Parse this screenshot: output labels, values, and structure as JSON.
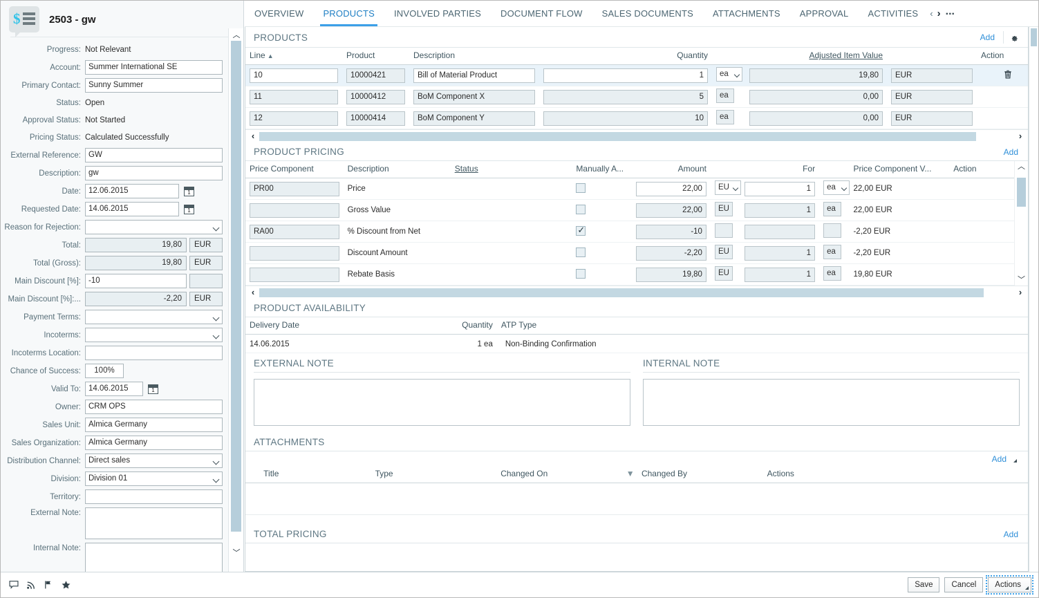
{
  "header": {
    "title": "2503 - gw",
    "icon": "sales-document-icon"
  },
  "tabs": [
    {
      "label": "OVERVIEW",
      "active": false
    },
    {
      "label": "PRODUCTS",
      "active": true
    },
    {
      "label": "INVOLVED PARTIES",
      "active": false
    },
    {
      "label": "DOCUMENT FLOW",
      "active": false
    },
    {
      "label": "SALES DOCUMENTS",
      "active": false
    },
    {
      "label": "ATTACHMENTS",
      "active": false
    },
    {
      "label": "APPROVAL",
      "active": false
    },
    {
      "label": "ACTIVITIES",
      "active": false
    }
  ],
  "tabnav": {
    "prev": "‹",
    "next": "›",
    "more": "..."
  },
  "sidebar": {
    "fields": [
      {
        "label": "Progress:",
        "value": "Not Relevant",
        "type": "text"
      },
      {
        "label": "Account:",
        "value": "Summer International SE",
        "type": "lookup"
      },
      {
        "label": "Primary Contact:",
        "value": "Sunny Summer",
        "type": "lookup"
      },
      {
        "label": "Status:",
        "value": "Open",
        "type": "text"
      },
      {
        "label": "Approval Status:",
        "value": "Not Started",
        "type": "text"
      },
      {
        "label": "Pricing Status:",
        "value": "Calculated Successfully",
        "type": "text"
      },
      {
        "label": "External Reference:",
        "value": "GW",
        "type": "input"
      },
      {
        "label": "Description:",
        "value": "gw",
        "type": "input"
      },
      {
        "label": "Date:",
        "value": "12.06.2015",
        "type": "date"
      },
      {
        "label": "Requested Date:",
        "value": "14.06.2015",
        "type": "date"
      },
      {
        "label": "Reason for Rejection:",
        "value": "",
        "type": "select"
      },
      {
        "label": "Total:",
        "value": "19,80",
        "currency": "EUR",
        "type": "amount"
      },
      {
        "label": "Total (Gross):",
        "value": "19,80",
        "currency": "EUR",
        "type": "amount"
      },
      {
        "label": "Main Discount [%]:",
        "value": "-10",
        "currency": "",
        "type": "amount-editable"
      },
      {
        "label": "Main Discount [%]:...",
        "value": "-2,20",
        "currency": "EUR",
        "type": "amount"
      },
      {
        "label": "Payment Terms:",
        "value": "",
        "type": "select"
      },
      {
        "label": "Incoterms:",
        "value": "",
        "type": "select"
      },
      {
        "label": "Incoterms Location:",
        "value": "",
        "type": "input"
      },
      {
        "label": "Chance of Success:",
        "value": "100%",
        "type": "pct"
      },
      {
        "label": "Valid To:",
        "value": "14.06.2015",
        "type": "date-narrow"
      },
      {
        "label": "Owner:",
        "value": "CRM OPS",
        "type": "lookup"
      },
      {
        "label": "Sales Unit:",
        "value": "Almica Germany",
        "type": "lookup"
      },
      {
        "label": "Sales Organization:",
        "value": "Almica Germany",
        "type": "lookup"
      },
      {
        "label": "Distribution Channel:",
        "value": "Direct sales",
        "type": "select"
      },
      {
        "label": "Division:",
        "value": "Division 01",
        "type": "select"
      },
      {
        "label": "Territory:",
        "value": "",
        "type": "lookup"
      },
      {
        "label": "External Note:",
        "value": "",
        "type": "textarea"
      },
      {
        "label": "Internal Note:",
        "value": "",
        "type": "textarea"
      }
    ]
  },
  "products": {
    "title": "PRODUCTS",
    "add_label": "Add",
    "settings_icon": "gear-icon",
    "columns": [
      "Line",
      "Product",
      "Description",
      "Quantity",
      "Adjusted Item Value",
      "Action"
    ],
    "sort_indicator": "▲",
    "rows": [
      {
        "line": "10",
        "product": "10000421",
        "description": "Bill of Material Product",
        "quantity": "1",
        "uom": "ea",
        "value": "19,80",
        "currency": "EUR",
        "selected": true,
        "has_delete": true,
        "has_lookup": true,
        "uom_dropdown": true
      },
      {
        "line": "11",
        "product": "10000412",
        "description": "BoM Component X",
        "quantity": "5",
        "uom": "ea",
        "value": "0,00",
        "currency": "EUR",
        "selected": false,
        "has_delete": false,
        "has_lookup": false,
        "uom_dropdown": false
      },
      {
        "line": "12",
        "product": "10000414",
        "description": "BoM Component Y",
        "quantity": "10",
        "uom": "ea",
        "value": "0,00",
        "currency": "EUR",
        "selected": false,
        "has_delete": false,
        "has_lookup": false,
        "uom_dropdown": false
      }
    ]
  },
  "pricing": {
    "title": "PRODUCT PRICING",
    "add_label": "Add",
    "columns": [
      "Price Component",
      "Description",
      "Status",
      "Manually A...",
      "Amount",
      "For",
      "Price Component V...",
      "Action"
    ],
    "rows": [
      {
        "component": "PR00",
        "description": "Price",
        "status": "",
        "manual": false,
        "amount": "22,00",
        "amount_currency": "EU",
        "for_qty": "1",
        "for_uom": "ea",
        "value": "22,00 EUR",
        "editable": true,
        "dropdowns": true
      },
      {
        "component": "",
        "description": "Gross Value",
        "status": "",
        "manual": false,
        "amount": "22,00",
        "amount_currency": "EU",
        "for_qty": "1",
        "for_uom": "ea",
        "value": "22,00 EUR",
        "editable": false,
        "dropdowns": false
      },
      {
        "component": "RA00",
        "description": "% Discount from Net",
        "status": "",
        "manual": true,
        "amount": "-10",
        "amount_currency": "",
        "for_qty": "",
        "for_uom": "",
        "value": "-2,20 EUR",
        "editable": false,
        "dropdowns": false
      },
      {
        "component": "",
        "description": "Discount Amount",
        "status": "",
        "manual": false,
        "amount": "-2,20",
        "amount_currency": "EU",
        "for_qty": "1",
        "for_uom": "ea",
        "value": "-2,20 EUR",
        "editable": false,
        "dropdowns": false
      },
      {
        "component": "",
        "description": "Rebate Basis",
        "status": "",
        "manual": false,
        "amount": "19,80",
        "amount_currency": "EU",
        "for_qty": "1",
        "for_uom": "ea",
        "value": "19,80 EUR",
        "editable": false,
        "dropdowns": false
      }
    ]
  },
  "availability": {
    "title": "PRODUCT AVAILABILITY",
    "columns": [
      "Delivery Date",
      "Quantity",
      "ATP Type"
    ],
    "rows": [
      {
        "date": "14.06.2015",
        "quantity": "1 ea",
        "atp_type": "Non-Binding Confirmation"
      }
    ]
  },
  "notes": {
    "external_title": "EXTERNAL NOTE",
    "external_value": "",
    "internal_title": "INTERNAL NOTE",
    "internal_value": ""
  },
  "attachments": {
    "title": "ATTACHMENTS",
    "add_label": "Add",
    "columns": [
      "Title",
      "Type",
      "Changed On",
      "Changed By",
      "Actions"
    ],
    "rows": []
  },
  "total_pricing": {
    "title": "TOTAL PRICING",
    "add_label": "Add"
  },
  "footer": {
    "icons": [
      "note-icon",
      "feed-icon",
      "flag-icon",
      "star-icon"
    ],
    "save_label": "Save",
    "cancel_label": "Cancel",
    "actions_label": "Actions"
  },
  "colors": {
    "accent": "#3ca0e8",
    "link": "#2f8fd8",
    "label": "#59707a",
    "selected_row": "#e9f3fa",
    "scroll_thumb": "#b6cedb"
  }
}
